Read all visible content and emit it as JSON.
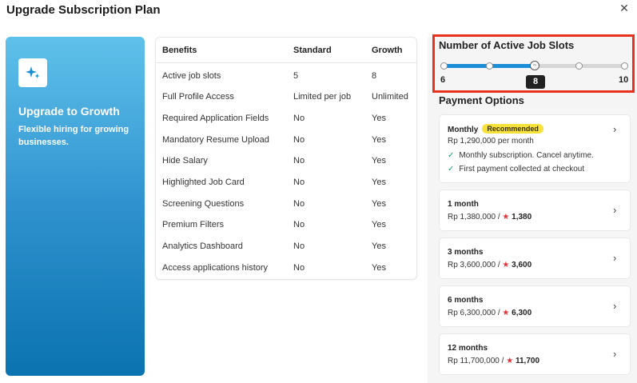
{
  "dialog": {
    "title": "Upgrade Subscription Plan",
    "close_icon": "close-icon"
  },
  "hero": {
    "icon": "sparkles-icon",
    "title": "Upgrade to Growth",
    "subtitle": "Flexible hiring for growing businesses.",
    "gradient": [
      "#5fc1ea",
      "#0a73b0"
    ]
  },
  "benefits": {
    "headers": [
      "Benefits",
      "Standard",
      "Growth"
    ],
    "rows": [
      [
        "Active job slots",
        "5",
        "8"
      ],
      [
        "Full Profile Access",
        "Limited per job",
        "Unlimited"
      ],
      [
        "Required Application Fields",
        "No",
        "Yes"
      ],
      [
        "Mandatory Resume Upload",
        "No",
        "Yes"
      ],
      [
        "Hide Salary",
        "No",
        "Yes"
      ],
      [
        "Highlighted Job Card",
        "No",
        "Yes"
      ],
      [
        "Screening Questions",
        "No",
        "Yes"
      ],
      [
        "Premium Filters",
        "No",
        "Yes"
      ],
      [
        "Analytics Dashboard",
        "No",
        "Yes"
      ],
      [
        "Access applications history",
        "No",
        "Yes"
      ]
    ]
  },
  "slots": {
    "title": "Number of Active Job Slots",
    "min": "6",
    "max": "10",
    "value": "8",
    "steps": [
      6,
      7,
      8,
      9,
      10
    ],
    "accent": "#1d8fd6",
    "highlight_color": "#e8321e"
  },
  "payment": {
    "title": "Payment Options",
    "monthly": {
      "name": "Monthly",
      "badge": "Recommended",
      "price": "Rp 1,290,000 per month",
      "features": [
        "Monthly subscription. Cancel anytime.",
        "First payment collected at checkout"
      ]
    },
    "plans": [
      {
        "name": "1 month",
        "price": "Rp 1,380,000 /",
        "points": "1,380"
      },
      {
        "name": "3 months",
        "price": "Rp 3,600,000 /",
        "points": "3,600"
      },
      {
        "name": "6 months",
        "price": "Rp 6,300,000 /",
        "points": "6,300"
      },
      {
        "name": "12 months",
        "price": "Rp 11,700,000 /",
        "points": "11,700"
      }
    ]
  }
}
